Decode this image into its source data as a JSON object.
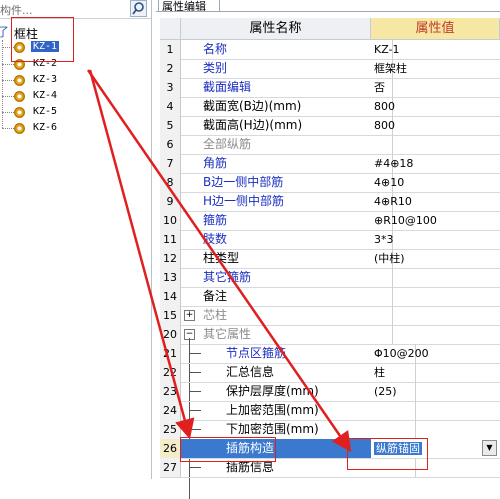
{
  "left_panel": {
    "search_placeholder": "构件...",
    "root_label": "框柱",
    "items": [
      "KZ-1",
      "KZ-2",
      "KZ-3",
      "KZ-4",
      "KZ-5",
      "KZ-6"
    ]
  },
  "right_panel": {
    "tab_label": "属性编辑",
    "header_name": "属性名称",
    "header_value": "属性值",
    "rows": [
      {
        "num": "1",
        "name": "名称",
        "value": "KZ-1"
      },
      {
        "num": "2",
        "name": "类别",
        "value": "框架柱"
      },
      {
        "num": "3",
        "name": "截面编辑",
        "value": "否"
      },
      {
        "num": "4",
        "name": "截面宽(B边)(mm)",
        "value": "800"
      },
      {
        "num": "5",
        "name": "截面高(H边)(mm)",
        "value": "800"
      },
      {
        "num": "6",
        "name": "全部纵筋",
        "value": ""
      },
      {
        "num": "7",
        "name": "角筋",
        "value": "#4⊕18"
      },
      {
        "num": "8",
        "name": "B边一侧中部筋",
        "value": "4⊕10"
      },
      {
        "num": "9",
        "name": "H边一侧中部筋",
        "value": "4⊕R10"
      },
      {
        "num": "10",
        "name": "箍筋",
        "value": "⊕R10@100"
      },
      {
        "num": "11",
        "name": "肢数",
        "value": "3*3"
      },
      {
        "num": "12",
        "name": "柱类型",
        "value": "(中柱)"
      },
      {
        "num": "13",
        "name": "其它箍筋",
        "value": ""
      },
      {
        "num": "14",
        "name": "备注",
        "value": ""
      },
      {
        "num": "15",
        "name": "芯柱",
        "value": ""
      },
      {
        "num": "20",
        "name": "其它属性",
        "value": ""
      },
      {
        "num": "21",
        "name": "节点区箍筋",
        "value": "Φ10@200"
      },
      {
        "num": "22",
        "name": "汇总信息",
        "value": "柱"
      },
      {
        "num": "23",
        "name": "保护层厚度(mm)",
        "value": "(25)"
      },
      {
        "num": "24",
        "name": "上加密范围(mm)",
        "value": ""
      },
      {
        "num": "25",
        "name": "下加密范围(mm)",
        "value": ""
      },
      {
        "num": "26",
        "name": "插筋构造",
        "value": "纵筋锚固"
      },
      {
        "num": "27",
        "name": "插筋信息",
        "value": ""
      }
    ]
  },
  "colors": {
    "accent": "#3b79cf",
    "annotation": "#e02020",
    "blue_text": "#1a2fbf",
    "header_value_bg": "#f7e7a4"
  },
  "icons": [
    "search-icon",
    "expand-icon",
    "gear-icon",
    "dropdown-arrow-icon"
  ]
}
